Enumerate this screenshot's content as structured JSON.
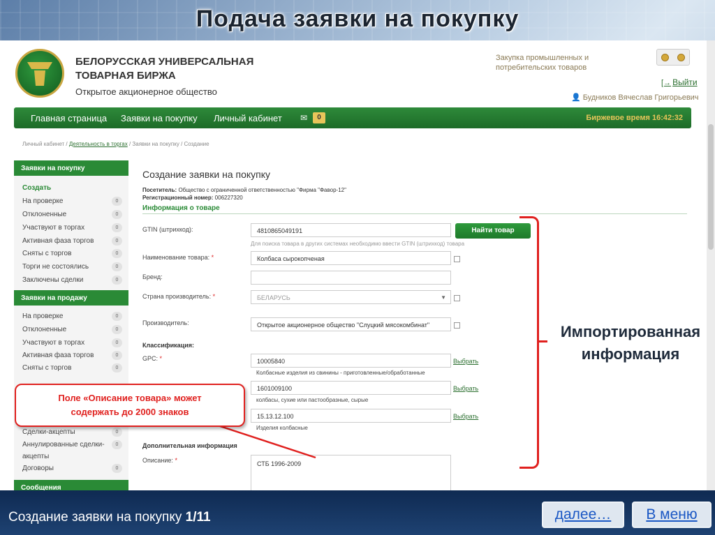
{
  "slide": {
    "title": "Подача заявки на покупку",
    "footer_text": "Создание заявки на покупку",
    "footer_page": "1/11",
    "next_label": "далее…",
    "menu_label": "В меню"
  },
  "header": {
    "org_line1": "БЕЛОРУССКАЯ УНИВЕРСАЛЬНАЯ",
    "org_line2": "ТОВАРНАЯ БИРЖА",
    "org_type": "Открытое акционерное общество",
    "tagline": "Закупка промышленных и потребительских товаров",
    "logout": "Выйти",
    "user": "Будников Вячеслав Григорьевич"
  },
  "nav": {
    "items": [
      "Главная страница",
      "Заявки на покупку",
      "Личный кабинет"
    ],
    "mail_count": "0",
    "exchange_time": "Биржевое время 16:42:32"
  },
  "breadcrumb": {
    "root": "Личный кабинет /",
    "link": "Деятельность в торгах",
    "rest": "/ Заявки на покупку / Создание"
  },
  "sidebar": {
    "buy_header": "Заявки на покупку",
    "buy_items": [
      {
        "label": "Создать",
        "count": ""
      },
      {
        "label": "На проверке",
        "count": "0"
      },
      {
        "label": "Отклоненные",
        "count": "0"
      },
      {
        "label": "Участвуют в торгах",
        "count": "0"
      },
      {
        "label": "Активная фаза торгов",
        "count": "0"
      },
      {
        "label": "Сняты с торгов",
        "count": "0"
      },
      {
        "label": "Торги не состоялись",
        "count": "0"
      },
      {
        "label": "Заключены сделки",
        "count": "0"
      }
    ],
    "sell_header": "Заявки на продажу",
    "sell_items": [
      {
        "label": "На проверке",
        "count": "0"
      },
      {
        "label": "Отклоненные",
        "count": "0"
      },
      {
        "label": "Участвуют в торгах",
        "count": "0"
      },
      {
        "label": "Активная фаза торгов",
        "count": "0"
      },
      {
        "label": "Сняты с торгов",
        "count": "0"
      }
    ],
    "extra_items": [
      {
        "label": "Сделки-акцепты",
        "count": "0"
      },
      {
        "label": "Аннулированные сделки-",
        "count": "0"
      },
      {
        "label": "акцепты",
        "count": ""
      },
      {
        "label": "Договоры",
        "count": "0"
      }
    ],
    "messages_header": "Сообщения"
  },
  "form": {
    "title": "Создание заявки на покупку",
    "visitor_label": "Посетитель:",
    "visitor_value": "Общество с ограниченной ответственностью \"Фирма \"Фавор-12\"",
    "reg_label": "Регистрационный номер:",
    "reg_value": "006227320",
    "section": "Информация о товаре",
    "gtin_label": "GTIN (штрихкод):",
    "gtin_value": "4810865049191",
    "find_button": "Найти товар",
    "gtin_hint": "Для поиска товара в других системах необходимо ввести GTIN (штрихкод) товара",
    "name_label": "Наименование товара:",
    "name_value": "Колбаса сырокопченая",
    "brand_label": "Бренд:",
    "brand_value": "",
    "country_label": "Страна производитель:",
    "country_value": "БЕЛАРУСЬ",
    "maker_label": "Производитель:",
    "maker_value": "Открытое акционерное общество \"Слуцкий мясокомбинат\"",
    "class_label": "Классификация:",
    "gpc_label": "GPC:",
    "gpc1_value": "10005840",
    "gpc1_desc": "Колбасные изделия из свинины - приготовленные/обработанные",
    "gpc2_value": "1601009100",
    "gpc2_desc": "колбасы, сухие или пастообразные, сырые",
    "gpc3_value": "15.13.12.100",
    "gpc3_desc": "Изделия колбасные",
    "choose_label": "Выбрать",
    "extra_label": "Дополнительная информация",
    "desc_label": "Описание:",
    "desc_value": "СТБ 1996-2009",
    "required_mark": "*"
  },
  "annotations": {
    "imported_line1": "Импортированная",
    "imported_line2": "информация",
    "callout_line1": "Поле «Описание товара» может",
    "callout_line2": "содержать до 2000 знаков"
  },
  "colors": {
    "brand_green": "#2a8a36",
    "accent_red": "#e0201e",
    "gold": "#e8c55a"
  }
}
